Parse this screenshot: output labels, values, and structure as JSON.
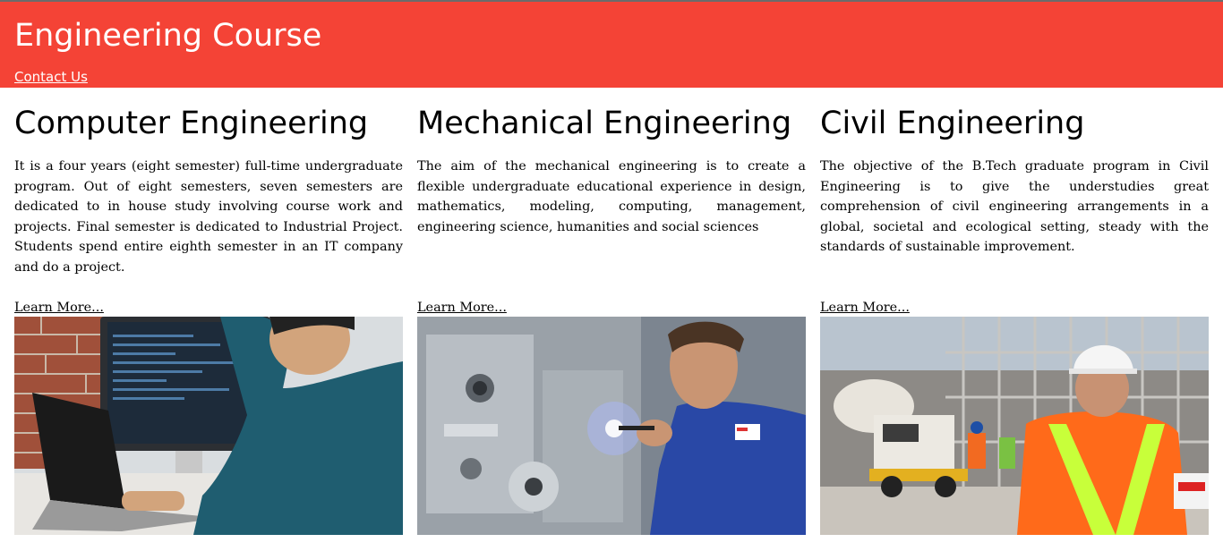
{
  "header": {
    "title": "Engineering Course",
    "contact_label": "Contact Us",
    "bg_color": "#f44336"
  },
  "columns": [
    {
      "title": "Computer Engineering",
      "text": "It is a four years (eight semester) full-time undergraduate program. Out of eight semesters, seven semesters are dedicated to in house study involving course work and projects. Final semester is dedicated to Industrial Project. Students spend entire eighth semester in an IT company and do a project.",
      "link": "Learn More...",
      "image": "person-at-computer-photo"
    },
    {
      "title": "Mechanical Engineering",
      "text": "The aim of the mechanical engineering is to create a flexible undergraduate educational experience in design, mathematics, modeling, computing, management, engineering science, humanities and social sciences",
      "link": "Learn More...",
      "image": "machinist-photo"
    },
    {
      "title": "Civil Engineering",
      "text": "The objective of the B.Tech graduate program in Civil Engineering is to give the understudies great comprehension of civil engineering arrangements in a global, societal and ecological setting, steady with the standards of sustainable improvement.",
      "link": "Learn More...",
      "image": "construction-site-photo"
    }
  ]
}
